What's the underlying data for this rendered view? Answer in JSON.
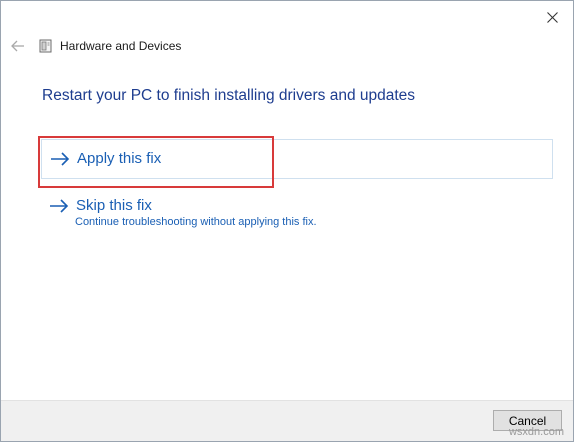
{
  "window": {
    "title": "Hardware and Devices",
    "close_icon": "close-icon",
    "back_icon": "back-arrow-icon",
    "app_icon": "hardware-devices-icon"
  },
  "main": {
    "instruction": "Restart your PC to finish installing drivers and updates",
    "options": [
      {
        "title": "Apply this fix",
        "description": "",
        "icon": "arrow-right-icon"
      },
      {
        "title": "Skip this fix",
        "description": "Continue troubleshooting without applying this fix.",
        "icon": "arrow-right-icon"
      }
    ]
  },
  "footer": {
    "cancel_label": "Cancel"
  },
  "watermark": "wsxdn.com",
  "colors": {
    "link": "#1a5fb4",
    "instruction": "#1e3d8f",
    "highlight": "#d83a3a"
  }
}
